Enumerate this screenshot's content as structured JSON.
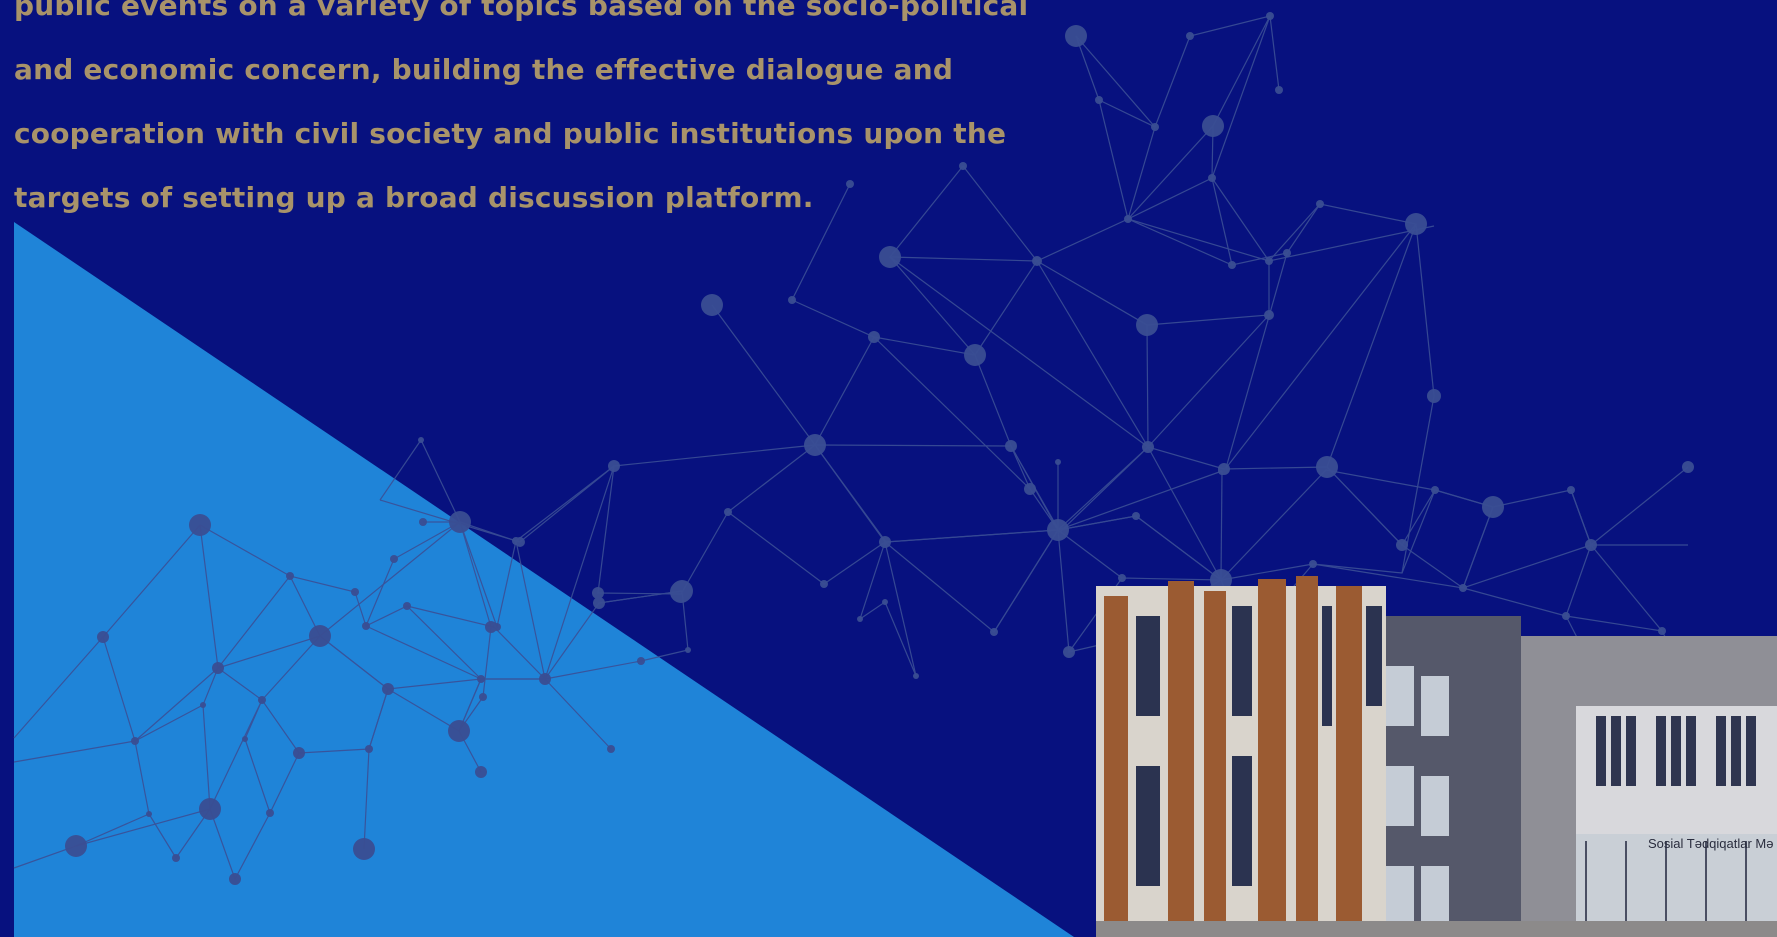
{
  "intro": {
    "lines": [
      "public events on a variety of topics based on the socio-political",
      "and economic concern, building the effective dialogue and",
      "cooperation with civil society and public institutions upon the",
      "targets of setting up a broad discussion platform."
    ]
  },
  "building": {
    "sign_text": "Sosial Tədqiqatlar Mə"
  },
  "icons": {
    "pin": "location-pin-icon"
  },
  "colors": {
    "background": "#07117f",
    "triangle": "#1f84d8",
    "text": "#a8936a",
    "network_line": "#3b4f96",
    "network_node": "#3a4e93"
  }
}
